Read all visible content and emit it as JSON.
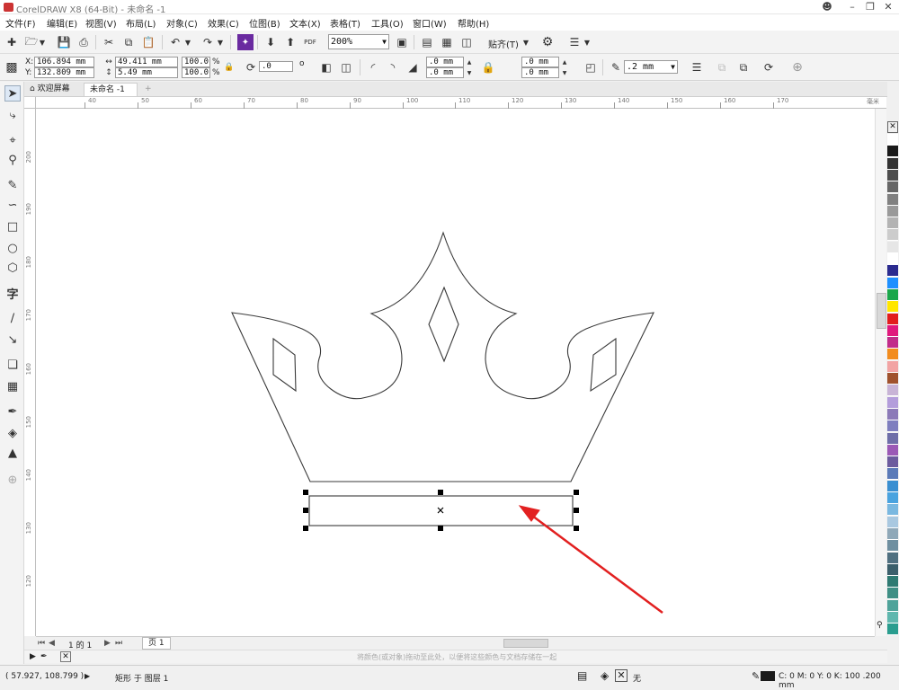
{
  "title": "CorelDRAW X8 (64-Bit) - 未命名 -1",
  "menu": [
    "文件(F)",
    "编辑(E)",
    "视图(V)",
    "布局(L)",
    "对象(C)",
    "效果(C)",
    "位图(B)",
    "文本(X)",
    "表格(T)",
    "工具(O)",
    "窗口(W)",
    "帮助(H)"
  ],
  "toolbar": {
    "zoom": "200%",
    "snap_label": "贴齐(T)",
    "pdf_label": "PDF"
  },
  "props": {
    "x": "106.894 mm",
    "y": "132.809 mm",
    "w": "49.411 mm",
    "h": "5.49 mm",
    "sx": "100.0",
    "sy": "100.0",
    "pct": "%",
    "pct2": "%",
    "x_lbl": "X:",
    "y_lbl": "Y:",
    "angle": ".0",
    "deg": "o",
    "c1": ".0 mm",
    "c2": ".0 mm",
    "c3": ".0 mm",
    "c4": ".0 mm",
    "outline": ".2 mm"
  },
  "tabs": {
    "welcome": "欢迎屏幕",
    "doc": "未命名 -1"
  },
  "tools_text": {
    "text_tool": "字"
  },
  "ruler": {
    "top": [
      "40",
      "50",
      "60",
      "70",
      "80",
      "90",
      "100",
      "110",
      "120",
      "130",
      "140",
      "150",
      "160",
      "170"
    ],
    "unit": "毫米",
    "left": [
      "200",
      "190",
      "180",
      "170",
      "160",
      "150",
      "140",
      "130",
      "120"
    ]
  },
  "pagebar": {
    "page_count": "1 的 1",
    "page_tab": "页 1"
  },
  "dropbar": {
    "hint": "将颜色(或对象)拖动至此处，以便将这些颜色与文档存储在一起"
  },
  "status": {
    "coords": "( 57.927, 108.799 )",
    "object": "矩形 于 图层 1",
    "fill": "无",
    "outline": "C: 0 M: 0 Y: 0 K: 100  .200 mm"
  },
  "palette": [
    "#ffffff",
    "#1a1a1a",
    "#333333",
    "#4d4d4d",
    "#666666",
    "#808080",
    "#999999",
    "#b3b3b3",
    "#cccccc",
    "#e6e6e6",
    "#ffffff",
    "#2b2b8f",
    "#1e90ff",
    "#1aa64a",
    "#ffe600",
    "#e21d1d",
    "#e0197d",
    "#c12c8a",
    "#f28c1e",
    "#f2a4a4",
    "#a0522d",
    "#c8b4d6",
    "#b39ddb",
    "#8c7ab8",
    "#7f7fbf",
    "#6e6ea8",
    "#9b59b6",
    "#6c5b9e",
    "#5b7ab8",
    "#3a8fd1",
    "#4aa3df",
    "#7ab8e0",
    "#a9c8e0",
    "#8fa8b8",
    "#6f8fa0",
    "#507080",
    "#3b5f6b",
    "#2e7a72",
    "#3f8f85",
    "#4fa39a",
    "#5fb7ae",
    "#2a9d8f"
  ],
  "colors": {
    "accent_arrow": "#e22020",
    "selection": "#000000"
  }
}
